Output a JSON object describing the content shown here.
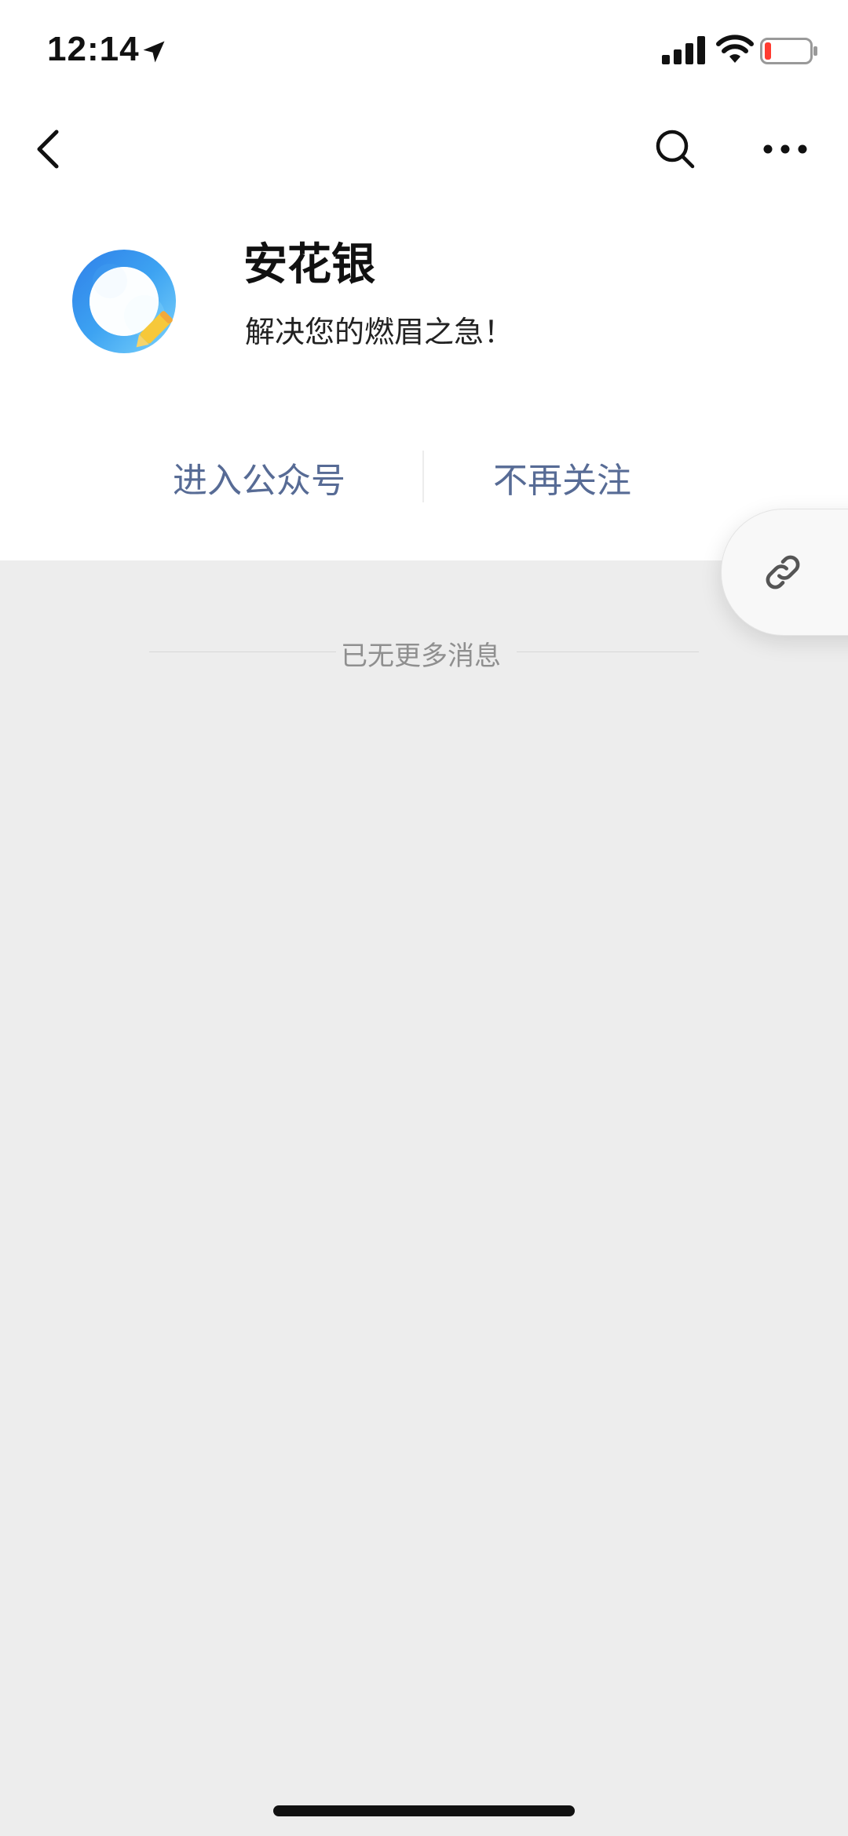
{
  "status_bar": {
    "time": "12:14",
    "icons": [
      "location-arrow-icon",
      "signal-icon",
      "wifi-icon",
      "battery-low-icon"
    ],
    "battery_level": 0.15,
    "battery_color": "#ff3b30"
  },
  "nav": {
    "icons": [
      "back-chevron-icon",
      "search-icon",
      "more-dots-icon"
    ]
  },
  "account": {
    "name": "安花银",
    "slogan": "解决您的燃眉之急！",
    "logo_icon": "q-pencil-logo"
  },
  "actions": {
    "enter_label": "进入公众号",
    "unfollow_label": "不再关注",
    "link_color": "#576b95"
  },
  "floating_button": {
    "icon": "link-icon"
  },
  "messages": {
    "end_text": "已无更多消息"
  },
  "colors": {
    "background": "#ededed",
    "header_background": "#ffffff"
  }
}
